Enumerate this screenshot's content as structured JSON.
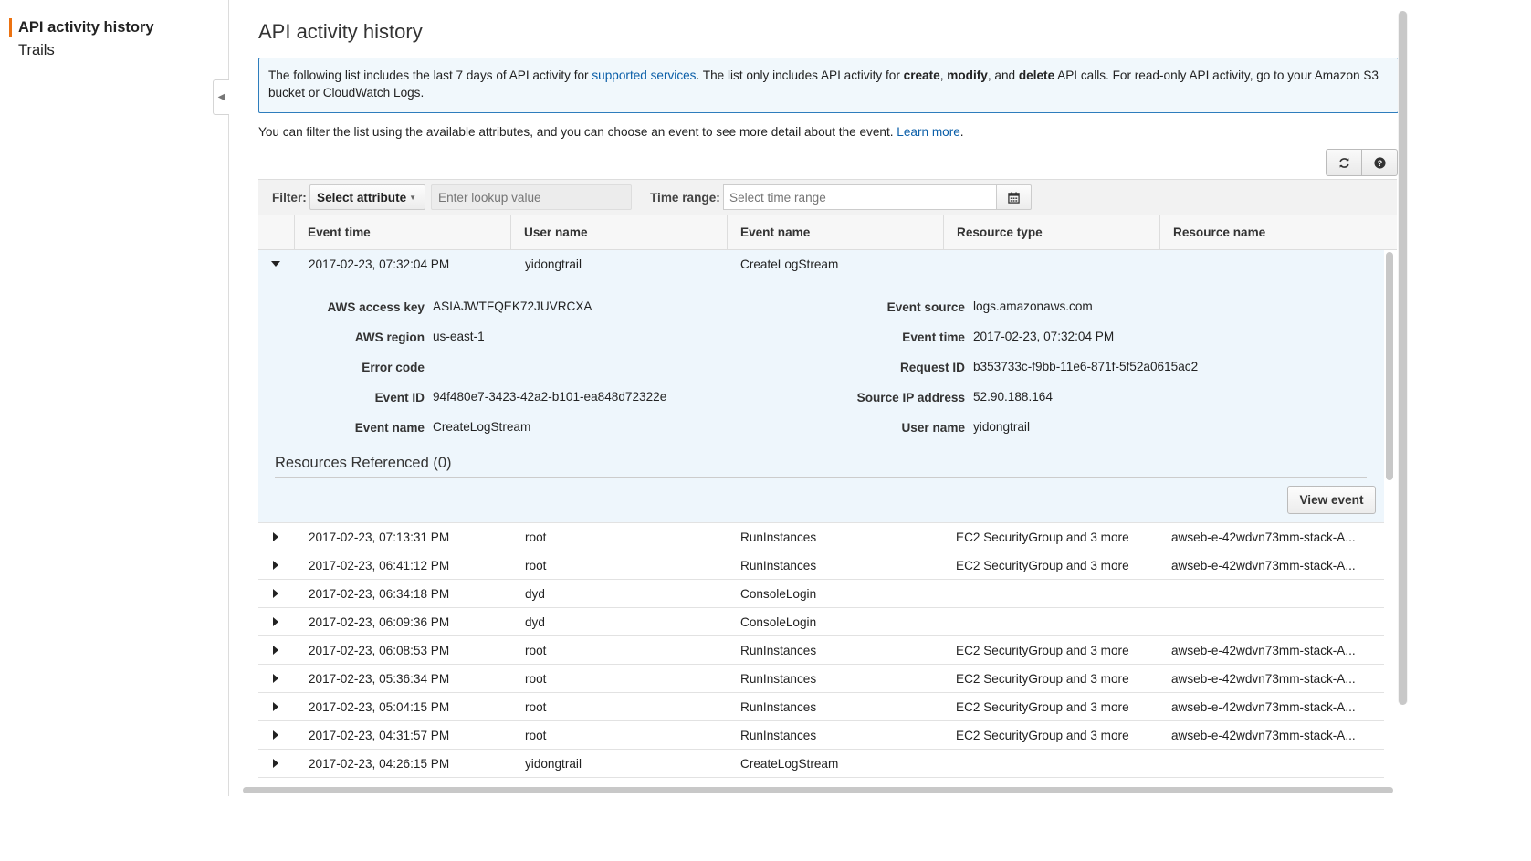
{
  "sidebar": {
    "items": [
      {
        "label": "API activity history",
        "active": true
      },
      {
        "label": "Trails",
        "active": false
      }
    ]
  },
  "page": {
    "title": "API activity history",
    "info": {
      "t1": "The following list includes the last 7 days of API activity for ",
      "link": "supported services",
      "t2": ". The list only includes API activity for ",
      "b1": "create",
      "s1": ", ",
      "b2": "modify",
      "s2": ", and ",
      "b3": "delete",
      "t3": " API calls. For read-only API activity, go to your Amazon S3 bucket or CloudWatch Logs."
    },
    "help": {
      "text": "You can filter the list using the available attributes, and you can choose an event to see more detail about the event. ",
      "link": "Learn more",
      "end": "."
    }
  },
  "toolbar": {
    "refresh_icon": "refresh-icon",
    "help_icon": "question-circle-icon"
  },
  "filter": {
    "label": "Filter:",
    "attribute": "Select attribute",
    "lookup_placeholder": "Enter lookup value",
    "time_label": "Time range:",
    "time_placeholder": "Select time range",
    "calendar_icon": "calendar-icon"
  },
  "table": {
    "columns": [
      "Event time",
      "User name",
      "Event name",
      "Resource type",
      "Resource name"
    ],
    "expanded_row": {
      "event_time": "2017-02-23, 07:32:04 PM",
      "user_name": "yidongtrail",
      "event_name": "CreateLogStream",
      "resource_type": "",
      "resource_name": ""
    },
    "details": {
      "left": [
        {
          "label": "AWS access key",
          "value": "ASIAJWTFQEK72JUVRCXA"
        },
        {
          "label": "AWS region",
          "value": "us-east-1"
        },
        {
          "label": "Error code",
          "value": ""
        },
        {
          "label": "Event ID",
          "value": "94f480e7-3423-42a2-b101-ea848d72322e"
        },
        {
          "label": "Event name",
          "value": "CreateLogStream"
        }
      ],
      "right": [
        {
          "label": "Event source",
          "value": "logs.amazonaws.com"
        },
        {
          "label": "Event time",
          "value": "2017-02-23, 07:32:04 PM"
        },
        {
          "label": "Request ID",
          "value": "b353733c-f9bb-11e6-871f-5f52a0615ac2"
        },
        {
          "label": "Source IP address",
          "value": "52.90.188.164"
        },
        {
          "label": "User name",
          "value": "yidongtrail"
        }
      ],
      "resources_title": "Resources Referenced (0)",
      "view_button": "View event"
    },
    "rows": [
      {
        "time": "2017-02-23, 07:13:31 PM",
        "user": "root",
        "event": "RunInstances",
        "rtype": "EC2 SecurityGroup and 3 more",
        "rname": "awseb-e-42wdvn73mm-stack-A..."
      },
      {
        "time": "2017-02-23, 06:41:12 PM",
        "user": "root",
        "event": "RunInstances",
        "rtype": "EC2 SecurityGroup and 3 more",
        "rname": "awseb-e-42wdvn73mm-stack-A..."
      },
      {
        "time": "2017-02-23, 06:34:18 PM",
        "user": "dyd",
        "event": "ConsoleLogin",
        "rtype": "",
        "rname": ""
      },
      {
        "time": "2017-02-23, 06:09:36 PM",
        "user": "dyd",
        "event": "ConsoleLogin",
        "rtype": "",
        "rname": ""
      },
      {
        "time": "2017-02-23, 06:08:53 PM",
        "user": "root",
        "event": "RunInstances",
        "rtype": "EC2 SecurityGroup and 3 more",
        "rname": "awseb-e-42wdvn73mm-stack-A..."
      },
      {
        "time": "2017-02-23, 05:36:34 PM",
        "user": "root",
        "event": "RunInstances",
        "rtype": "EC2 SecurityGroup and 3 more",
        "rname": "awseb-e-42wdvn73mm-stack-A..."
      },
      {
        "time": "2017-02-23, 05:04:15 PM",
        "user": "root",
        "event": "RunInstances",
        "rtype": "EC2 SecurityGroup and 3 more",
        "rname": "awseb-e-42wdvn73mm-stack-A..."
      },
      {
        "time": "2017-02-23, 04:31:57 PM",
        "user": "root",
        "event": "RunInstances",
        "rtype": "EC2 SecurityGroup and 3 more",
        "rname": "awseb-e-42wdvn73mm-stack-A..."
      },
      {
        "time": "2017-02-23, 04:26:15 PM",
        "user": "yidongtrail",
        "event": "CreateLogStream",
        "rtype": "",
        "rname": ""
      }
    ]
  },
  "colors": {
    "accent": "#ec7211",
    "link": "#0a5ea8",
    "info_border": "#2e7dbd",
    "expanded_bg": "#eef6fc"
  }
}
